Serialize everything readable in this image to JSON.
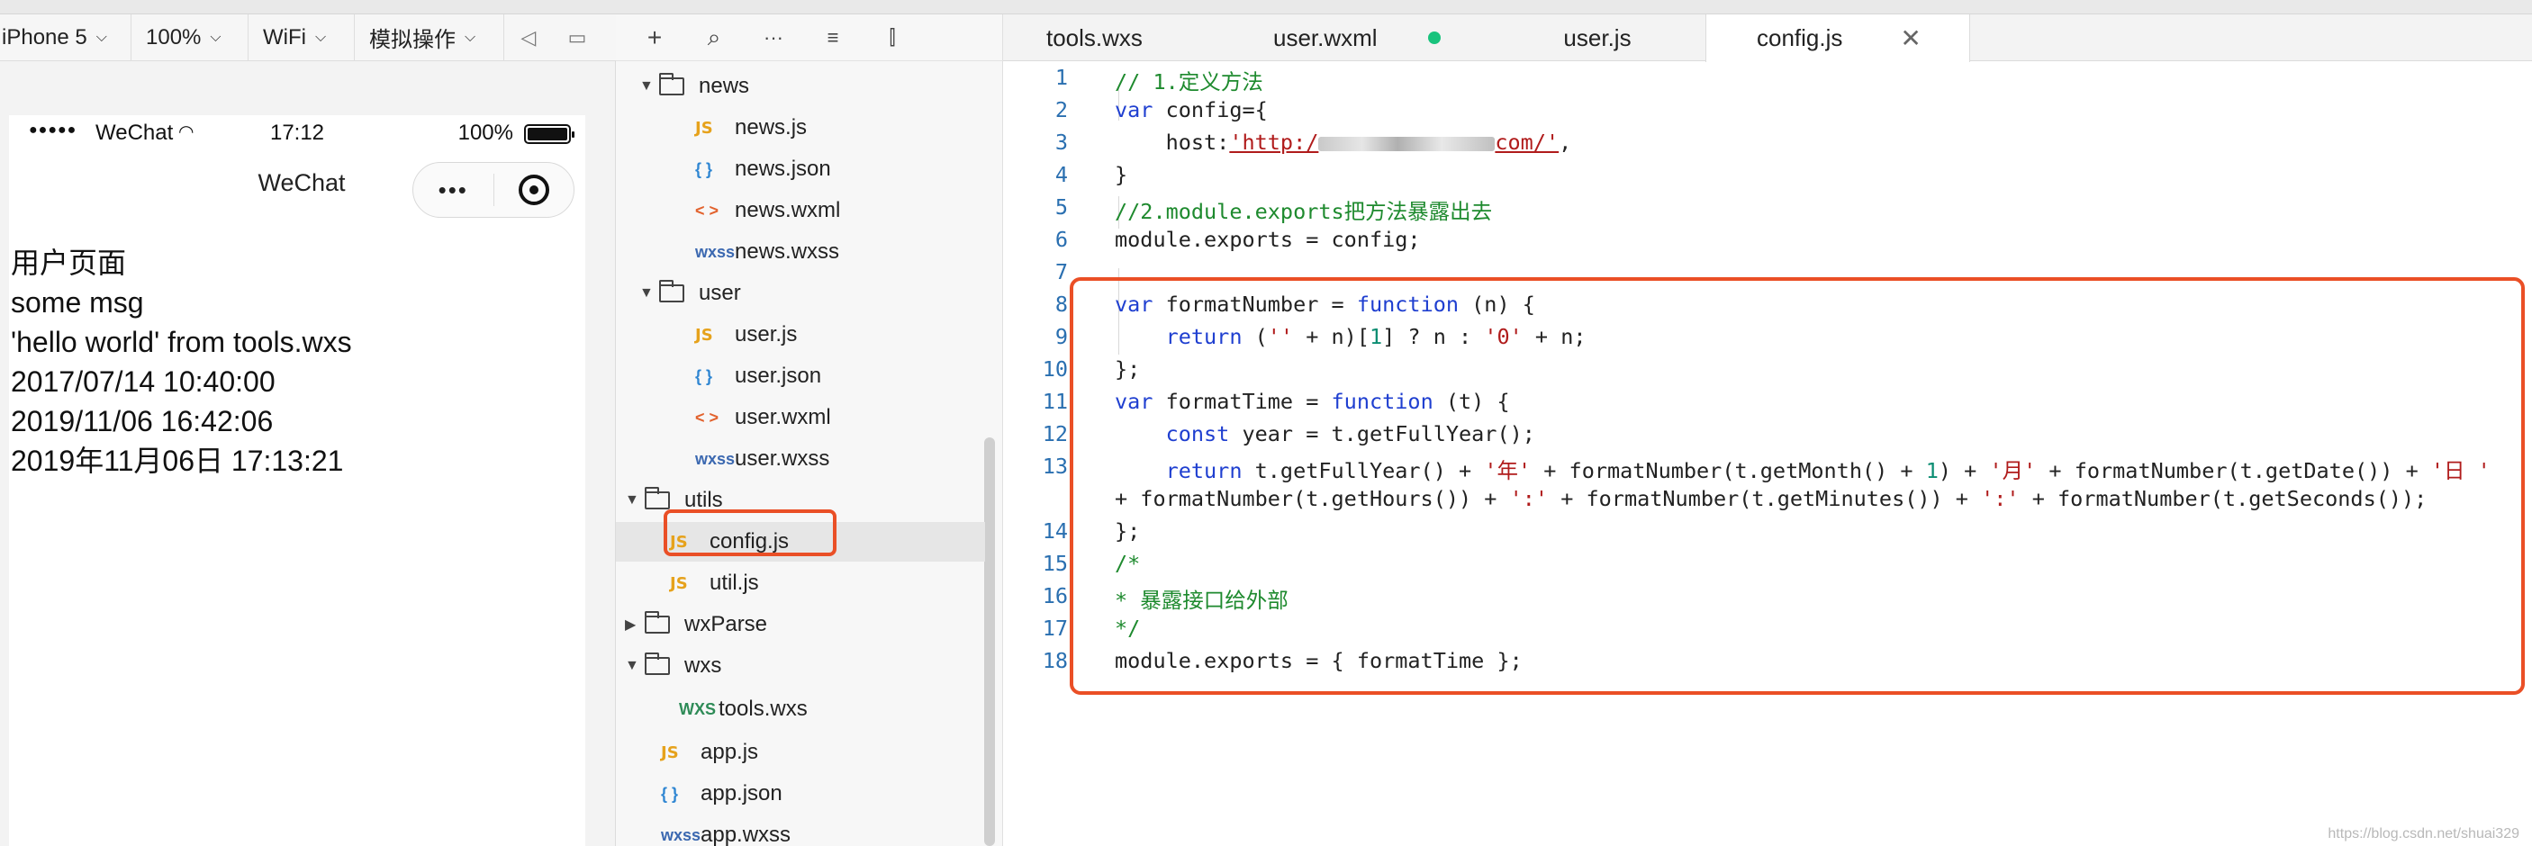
{
  "simulator": {
    "toolbar": {
      "device": "iPhone 5",
      "zoom": "100%",
      "network": "WiFi",
      "simulate": "模拟操作"
    },
    "status_bar": {
      "signal_dots": "●●●●●",
      "carrier": "WeChat",
      "time": "17:12",
      "battery": "100%"
    },
    "navbar": {
      "title": "WeChat",
      "more": "•••"
    },
    "content": [
      "用户页面",
      "some msg",
      "'hello world' from tools.wxs",
      "2017/07/14 10:40:00",
      "2019/11/06 16:42:06",
      "2019年11月06日 17:13:21"
    ]
  },
  "file_tree": {
    "toolbar_icons": [
      "add-icon",
      "search-icon",
      "more-icon",
      "outdent-icon",
      "split-icon"
    ],
    "items": [
      {
        "label": "news",
        "type": "folder"
      },
      {
        "label": "news.js",
        "type": "js"
      },
      {
        "label": "news.json",
        "type": "json"
      },
      {
        "label": "news.wxml",
        "type": "wxml"
      },
      {
        "label": "news.wxss",
        "type": "wxss"
      },
      {
        "label": "user",
        "type": "folder"
      },
      {
        "label": "user.js",
        "type": "js"
      },
      {
        "label": "user.json",
        "type": "json"
      },
      {
        "label": "user.wxml",
        "type": "wxml"
      },
      {
        "label": "user.wxss",
        "type": "wxss"
      },
      {
        "label": "utils",
        "type": "folder"
      },
      {
        "label": "config.js",
        "type": "js"
      },
      {
        "label": "util.js",
        "type": "js"
      },
      {
        "label": "wxParse",
        "type": "folder"
      },
      {
        "label": "wxs",
        "type": "folder"
      },
      {
        "label": "tools.wxs",
        "type": "wxs"
      },
      {
        "label": "app.js",
        "type": "js"
      },
      {
        "label": "app.json",
        "type": "json"
      },
      {
        "label": "app.wxss",
        "type": "wxss"
      }
    ],
    "icon_text": {
      "js": "JS",
      "json": "{ }",
      "wxml": "< >",
      "wxss": "wxss",
      "wxs": "WXS"
    }
  },
  "editor": {
    "tabs": [
      {
        "label": "tools.wxs"
      },
      {
        "label": "user.wxml"
      },
      {
        "label": "user.js"
      },
      {
        "label": "config.js"
      }
    ],
    "close_glyph": "✕",
    "line_numbers": [
      "1",
      "2",
      "3",
      "4",
      "5",
      "6",
      "7",
      "8",
      "9",
      "10",
      "11",
      "12",
      "13",
      "14",
      "15",
      "16",
      "17",
      "18"
    ],
    "code": {
      "l1": "// 1.定义方法",
      "l2_kw": "var",
      "l2": " config={",
      "l3_key": "host:",
      "l3_a": "'http:/",
      "l3_b": "com/'",
      "l3_c": ",",
      "l4": "}",
      "l5": "//2.module.exports把方法暴露出去",
      "l6": "module.exports = config;",
      "l8_kw": "var",
      "l8_a": " formatNumber = ",
      "l8_kw2": "function",
      "l8_b": " (n) {",
      "l9_kw": "return",
      "l9_a": " (",
      "l9_s1": "''",
      "l9_b": " + n)[",
      "l9_n": "1",
      "l9_c": "] ? n : ",
      "l9_s2": "'0'",
      "l9_d": " + n;",
      "l10": "};",
      "l11_kw": "var",
      "l11_a": " formatTime = ",
      "l11_kw2": "function",
      "l11_b": " (t) {",
      "l12_kw": "const",
      "l12": " year = t.getFullYear();",
      "l13_kw": "return",
      "l13_a": " t.getFullYear() + ",
      "l13_s1": "'年'",
      "l13_b": " + formatNumber(t.getMonth() + ",
      "l13_n": "1",
      "l13_c": ") + ",
      "l13_s2": "'月'",
      "l13_d": " + formatNumber(t.getDate()) + ",
      "l13_s3": "'日 '",
      "l13w_a": "+ formatNumber(t.getHours()) + ",
      "l13w_s1": "':'",
      "l13w_b": " + formatNumber(t.getMinutes()) + ",
      "l13w_s2": "':'",
      "l13w_c": " + formatNumber(t.getSeconds());",
      "l14": "};",
      "l15": "/*",
      "l16": "* 暴露接口给外部",
      "l17": "*/",
      "l18": "module.exports = { formatTime };"
    }
  },
  "colors": {
    "highlight_border": "#ea4f26",
    "keyword": "#1f3fd0",
    "comment": "#1e8a2e",
    "string": "#b01b1b",
    "modified_dot": "#19c37d"
  },
  "watermark": "https://blog.csdn.net/shuai329"
}
